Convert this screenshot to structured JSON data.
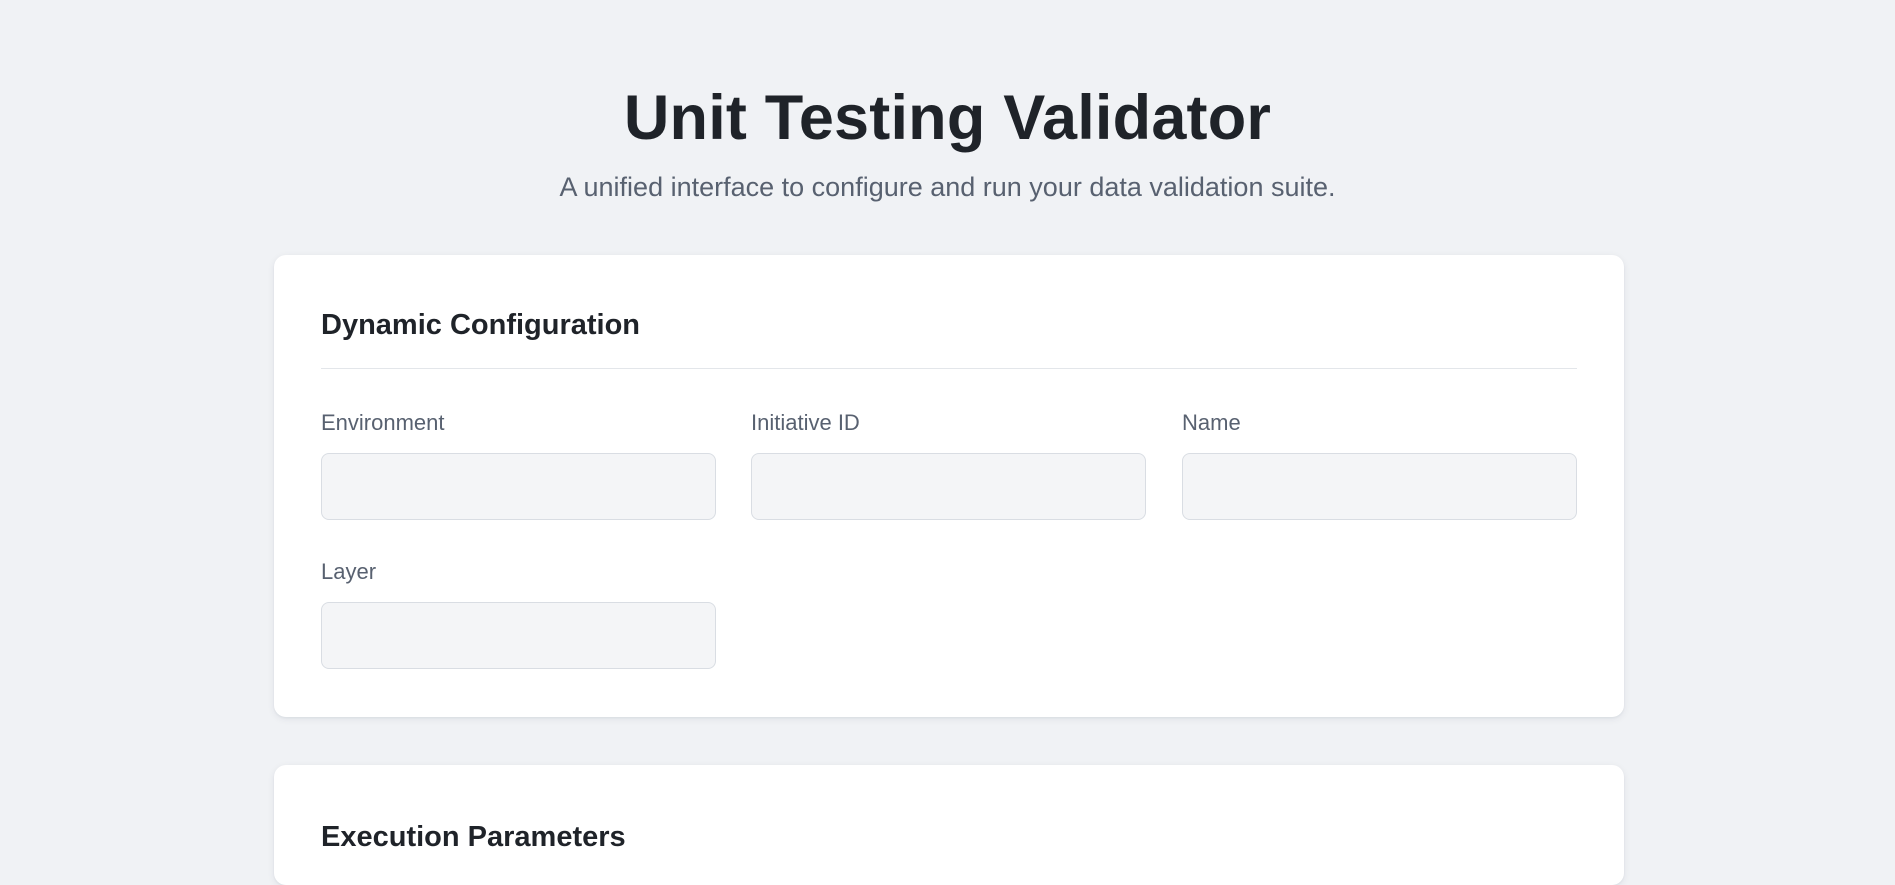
{
  "header": {
    "title": "Unit Testing Validator",
    "subtitle": "A unified interface to configure and run your data validation suite."
  },
  "dynamic_configuration": {
    "title": "Dynamic Configuration",
    "fields": [
      {
        "label": "Environment",
        "value": ""
      },
      {
        "label": "Initiative ID",
        "value": ""
      },
      {
        "label": "Name",
        "value": ""
      },
      {
        "label": "Layer",
        "value": ""
      }
    ]
  },
  "execution_parameters": {
    "title": "Execution Parameters"
  },
  "colors": {
    "background": "#f0f2f5",
    "card": "#ffffff",
    "title_text": "#1f2329",
    "muted_text": "#586170",
    "input_background": "#f4f5f7",
    "input_border": "#d9dde3"
  }
}
